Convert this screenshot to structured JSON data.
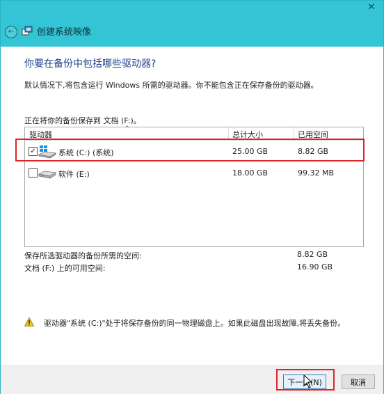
{
  "window": {
    "title": "创建系统映像",
    "close_glyph": "✕",
    "back_glyph": "←"
  },
  "page": {
    "heading": "你要在备份中包括哪些驱动器?",
    "description": "默认情况下,将包含运行 Windows 所需的驱动器。你不能包含正在保存备份的驱动器。",
    "saving_to": "正在将你的备份保存到 文档 (F:)。"
  },
  "drive_list": {
    "columns": [
      "驱动器",
      "总计大小",
      "已用空间"
    ],
    "rows": [
      {
        "checked": true,
        "check_glyph": "✓",
        "name": "系统 (C:) (系统)",
        "total": "25.00 GB",
        "used": "8.82 GB",
        "icon": "windows-drive-icon"
      },
      {
        "checked": false,
        "check_glyph": "",
        "name": "软件 (E:)",
        "total": "18.00 GB",
        "used": "99.32 MB",
        "icon": "hard-drive-icon"
      }
    ]
  },
  "summary": {
    "required_label": "保存所选驱动器的备份所需的空间:",
    "required_value": "8.82 GB",
    "available_label": "文档 (F:) 上的可用空间:",
    "available_value": "16.90 GB"
  },
  "warning": {
    "icon": "warning-icon",
    "text": "驱动器\"系统 (C:)\"处于将保存备份的同一物理磁盘上。如果此磁盘出现故障,将丢失备份。"
  },
  "footer": {
    "next_label": "下一步(N)",
    "cancel_label": "取消"
  },
  "colors": {
    "titlebar": "#33c4d5",
    "heading": "#1e3f8a",
    "highlight": "#e0252a"
  }
}
